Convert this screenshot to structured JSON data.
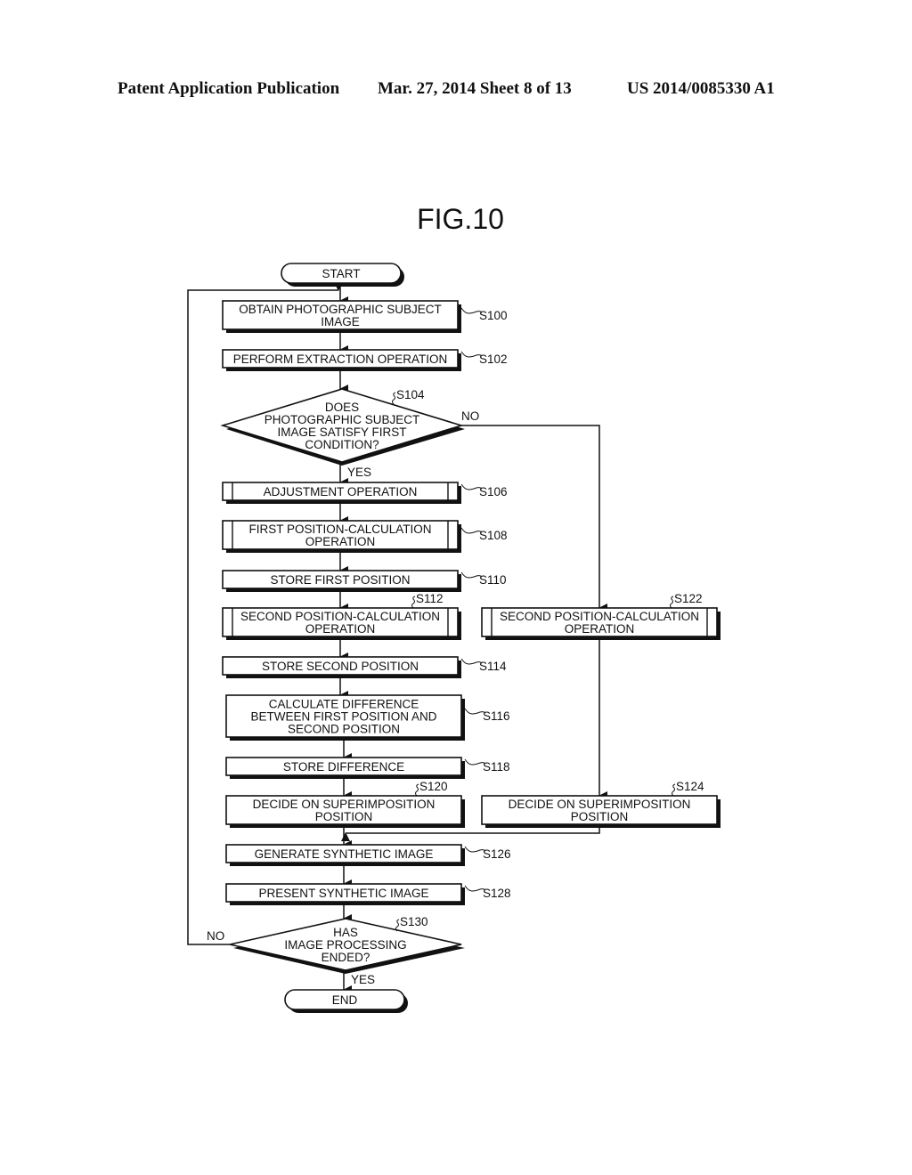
{
  "header": {
    "left": "Patent Application Publication",
    "middle": "Mar. 27, 2014  Sheet 8 of 13",
    "right": "US 2014/0085330 A1"
  },
  "figure": {
    "title": "FIG.10"
  },
  "nodes": {
    "start": {
      "type": "terminal",
      "lines": [
        "START"
      ]
    },
    "s100": {
      "type": "process",
      "step": "S100",
      "lines": [
        "OBTAIN PHOTOGRAPHIC SUBJECT",
        "IMAGE"
      ]
    },
    "s102": {
      "type": "process",
      "step": "S102",
      "lines": [
        "PERFORM EXTRACTION OPERATION"
      ]
    },
    "s104": {
      "type": "decision",
      "step": "S104",
      "lines": [
        "DOES",
        "PHOTOGRAPHIC SUBJECT",
        "IMAGE SATISFY FIRST",
        "CONDITION?"
      ]
    },
    "s106": {
      "type": "subroutine",
      "step": "S106",
      "lines": [
        "ADJUSTMENT OPERATION"
      ]
    },
    "s108": {
      "type": "subroutine",
      "step": "S108",
      "lines": [
        "FIRST POSITION-CALCULATION",
        "OPERATION"
      ]
    },
    "s110": {
      "type": "process",
      "step": "S110",
      "lines": [
        "STORE FIRST POSITION"
      ]
    },
    "s112": {
      "type": "subroutine",
      "step": "S112",
      "lines": [
        "SECOND POSITION-CALCULATION",
        "OPERATION"
      ]
    },
    "s114": {
      "type": "process",
      "step": "S114",
      "lines": [
        "STORE SECOND POSITION"
      ]
    },
    "s116": {
      "type": "process",
      "step": "S116",
      "lines": [
        "CALCULATE DIFFERENCE",
        "BETWEEN FIRST POSITION AND",
        "SECOND POSITION"
      ]
    },
    "s118": {
      "type": "process",
      "step": "S118",
      "lines": [
        "STORE DIFFERENCE"
      ]
    },
    "s120": {
      "type": "process",
      "step": "S120",
      "lines": [
        "DECIDE ON SUPERIMPOSITION",
        "POSITION"
      ]
    },
    "s122": {
      "type": "subroutine",
      "step": "S122",
      "lines": [
        "SECOND POSITION-CALCULATION",
        "OPERATION"
      ]
    },
    "s124": {
      "type": "process",
      "step": "S124",
      "lines": [
        "DECIDE ON SUPERIMPOSITION",
        "POSITION"
      ]
    },
    "s126": {
      "type": "process",
      "step": "S126",
      "lines": [
        "GENERATE SYNTHETIC IMAGE"
      ]
    },
    "s128": {
      "type": "process",
      "step": "S128",
      "lines": [
        "PRESENT SYNTHETIC IMAGE"
      ]
    },
    "s130": {
      "type": "decision",
      "step": "S130",
      "lines": [
        "HAS",
        "IMAGE PROCESSING",
        "ENDED?"
      ]
    },
    "end": {
      "type": "terminal",
      "lines": [
        "END"
      ]
    }
  },
  "edge_labels": {
    "s104_no": "NO",
    "s104_yes": "YES",
    "s130_no": "NO",
    "s130_yes": "YES"
  },
  "edges": [
    [
      "start",
      "s100"
    ],
    [
      "s100",
      "s102"
    ],
    [
      "s102",
      "s104"
    ],
    [
      "s104",
      "s106",
      "YES"
    ],
    [
      "s104",
      "s122",
      "NO"
    ],
    [
      "s106",
      "s108"
    ],
    [
      "s108",
      "s110"
    ],
    [
      "s110",
      "s112"
    ],
    [
      "s112",
      "s114"
    ],
    [
      "s114",
      "s116"
    ],
    [
      "s116",
      "s118"
    ],
    [
      "s118",
      "s120"
    ],
    [
      "s120",
      "s126"
    ],
    [
      "s122",
      "s124"
    ],
    [
      "s124",
      "s126"
    ],
    [
      "s126",
      "s128"
    ],
    [
      "s128",
      "s130"
    ],
    [
      "s130",
      "end",
      "YES"
    ],
    [
      "s130",
      "s100",
      "NO"
    ]
  ]
}
